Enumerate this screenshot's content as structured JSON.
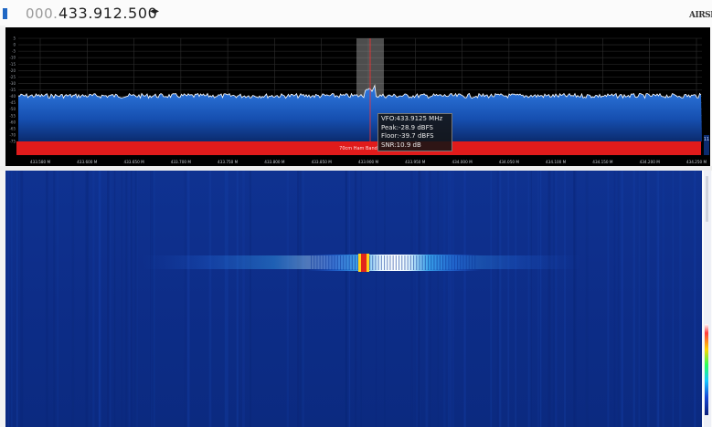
{
  "frequency": {
    "leading": "000.",
    "main": "433.912.500",
    "arrows": "◂▸"
  },
  "brand": "AIRSPY",
  "spectrum": {
    "db_ticks": [
      "5",
      "0",
      "-5",
      "-10",
      "-15",
      "-20",
      "-25",
      "-30",
      "-35",
      "-40",
      "-45",
      "-50",
      "-55",
      "-60",
      "-65",
      "-70",
      "-75"
    ],
    "freq_ticks": [
      "433.580 M",
      "433.600 M",
      "433.650 M",
      "433.700 M",
      "433.750 M",
      "433.800 M",
      "433.850 M",
      "433.900 M",
      "433.950 M",
      "434.000 M",
      "434.050 M",
      "434.100 M",
      "434.150 M",
      "434.200 M",
      "434.250 M"
    ],
    "band_label": "70cm Ham Band",
    "right_value": "11"
  },
  "tooltip": {
    "vfo": "VFO:433.9125 MHz",
    "peak": "Peak:-28.9 dBFS",
    "floor": "Floor:-39.7 dBFS",
    "snr": "SNR:10.9 dB"
  },
  "colors": {
    "spectrum_fill": "#1b63c8",
    "band_bar": "#e01b1b",
    "vfo_line": "#ff3030",
    "waterfall_bg": "#0d2d88"
  }
}
